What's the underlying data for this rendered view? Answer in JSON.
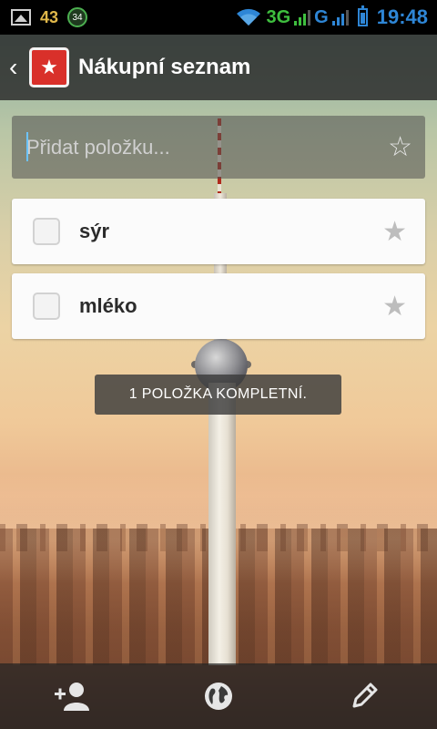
{
  "status_bar": {
    "notification_count": "43",
    "badge_count": "34",
    "network_label_1": "3G",
    "network_label_2": "G",
    "time": "19:48"
  },
  "header": {
    "title": "Nákupní seznam",
    "back_icon": "chevron-left-icon",
    "logo_icon": "wunderlist-star-icon"
  },
  "add_item": {
    "placeholder": "Přidat položku...",
    "star_icon": "star-outline-icon"
  },
  "tasks": [
    {
      "label": "sýr",
      "completed": false,
      "starred": false
    },
    {
      "label": "mléko",
      "completed": false,
      "starred": false
    }
  ],
  "toast": {
    "text": "1 POLOŽKA KOMPLETNÍ."
  },
  "bottom_bar": {
    "items": [
      {
        "icon": "add-person-icon"
      },
      {
        "icon": "globe-icon"
      },
      {
        "icon": "pencil-icon"
      }
    ]
  },
  "colors": {
    "accent": "#d9302a",
    "status_green": "#3fbf3f",
    "status_blue": "#2e86d6"
  }
}
